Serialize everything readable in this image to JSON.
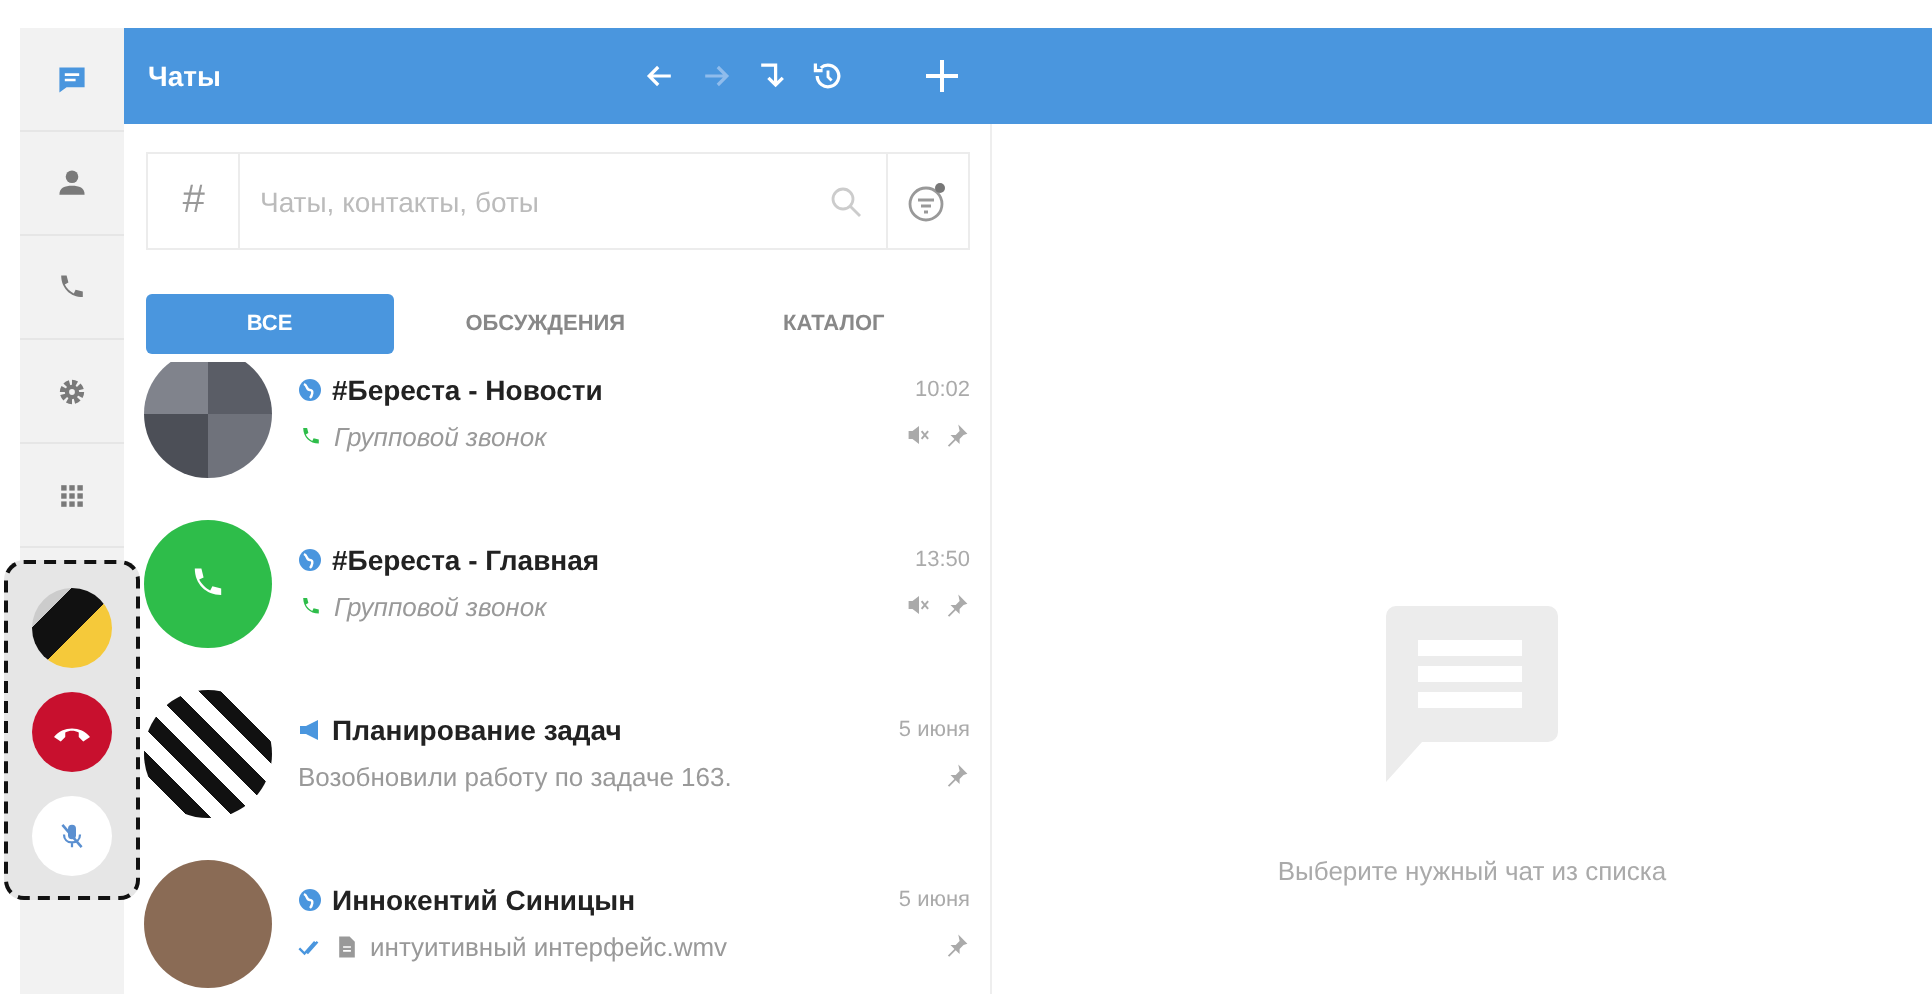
{
  "nav": {
    "items": [
      {
        "kind": "chat",
        "selected": true
      },
      {
        "kind": "contacts",
        "selected": false
      },
      {
        "kind": "calls",
        "selected": false
      },
      {
        "kind": "settings",
        "selected": false
      },
      {
        "kind": "apps",
        "selected": false
      }
    ],
    "call_panel": {
      "muted": true
    }
  },
  "header": {
    "title": "Чаты"
  },
  "search": {
    "prefix": "#",
    "placeholder": "Чаты, контакты, боты"
  },
  "tabs": [
    {
      "label": "ВСЕ",
      "selected": true
    },
    {
      "label": "ОБСУЖДЕНИЯ",
      "selected": false
    },
    {
      "label": "КАТАЛОГ",
      "selected": false
    }
  ],
  "chats": [
    {
      "kind": "group",
      "name": "#Береста - Новости",
      "preview": "Групповой звонок",
      "time": "10:02",
      "muted": true,
      "pinned": true
    },
    {
      "kind": "call",
      "name": "#Береста - Главная",
      "preview": "Групповой звонок",
      "time": "13:50",
      "muted": true,
      "pinned": true
    },
    {
      "kind": "channel",
      "name": "Планирование задач",
      "preview": "Возобновили работу по задаче 163.",
      "time": "5 июня",
      "muted": false,
      "pinned": true
    },
    {
      "kind": "person",
      "name": "Иннокентий Синицын",
      "preview": "интуитивный интерфейс.wmv",
      "time": "5 июня",
      "muted": false,
      "pinned": true
    }
  ],
  "empty": {
    "text": "Выберите нужный чат из списка"
  }
}
